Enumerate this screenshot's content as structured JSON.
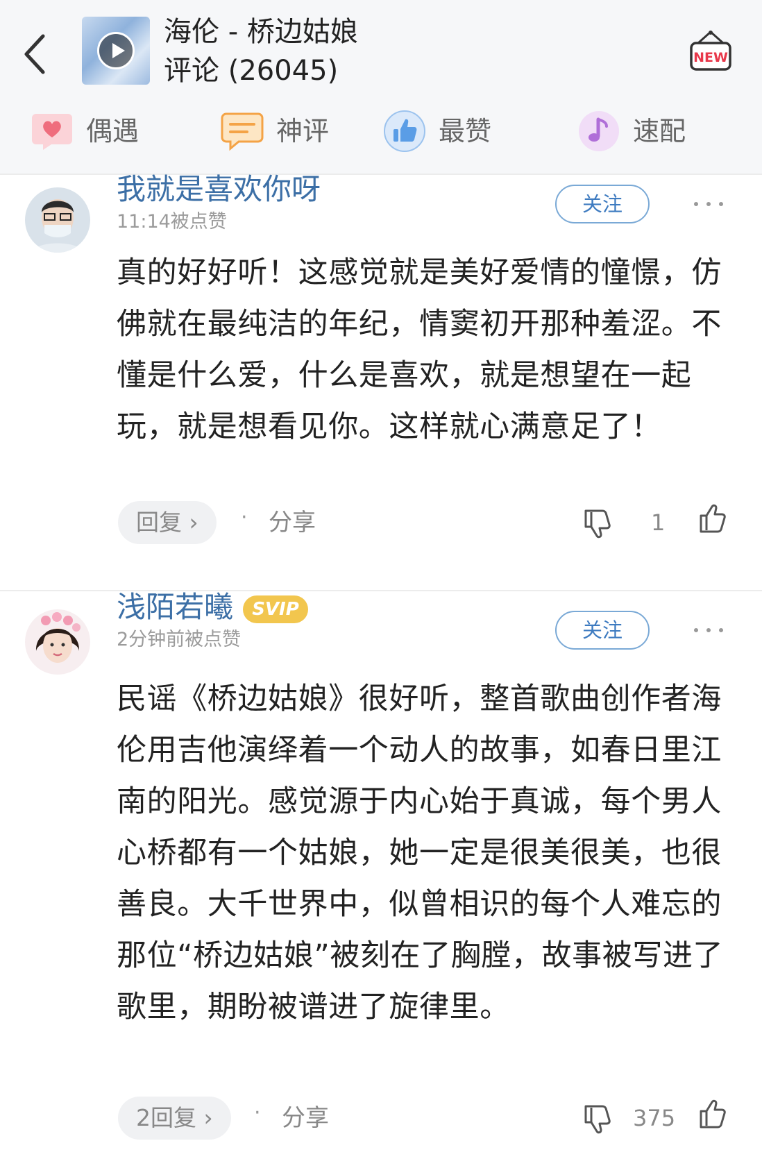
{
  "header": {
    "title": "海伦 - 桥边姑娘",
    "subtitle": "评论 (26045)",
    "new_badge": "NEW"
  },
  "tabs": [
    {
      "label": "偶遇",
      "icon": "heart-chat-icon",
      "color": "#f27f8d"
    },
    {
      "label": "神评",
      "icon": "message-lines-icon",
      "color": "#f4a346"
    },
    {
      "label": "最赞",
      "icon": "thumbs-up-icon",
      "color": "#5a9de6"
    },
    {
      "label": "速配",
      "icon": "music-note-icon",
      "color": "#b06fd8"
    }
  ],
  "comments": [
    {
      "username": "我就是喜欢你呀",
      "timestamp": "11:14被点赞",
      "follow_label": "关注",
      "text": "真的好好听！这感觉就是美好爱情的憧憬，仿佛就在最纯洁的年纪，情窦初开那种羞涩。不懂是什么爱，什么是喜欢，就是想望在一起玩，就是想看见你。这样就心满意足了！",
      "reply_label": "回复 ›",
      "share_label": "分享",
      "dot": "·",
      "like_count": "1"
    },
    {
      "username": "浅陌若曦",
      "badge": "SVIP",
      "timestamp": "2分钟前被点赞",
      "follow_label": "关注",
      "text": "民谣《桥边姑娘》很好听，整首歌曲创作者海伦用吉他演绎着一个动人的故事，如春日里江南的阳光。感觉源于内心始于真诚，每个男人心桥都有一个姑娘，她一定是很美很美，也很善良。大千世界中，似曾相识的每个人难忘的那位“桥边姑娘”被刻在了胸膛，故事被写进了歌里，期盼被谱进了旋律里。",
      "reply_label": "2回复 ›",
      "share_label": "分享",
      "dot": "·",
      "like_count": "375"
    }
  ]
}
